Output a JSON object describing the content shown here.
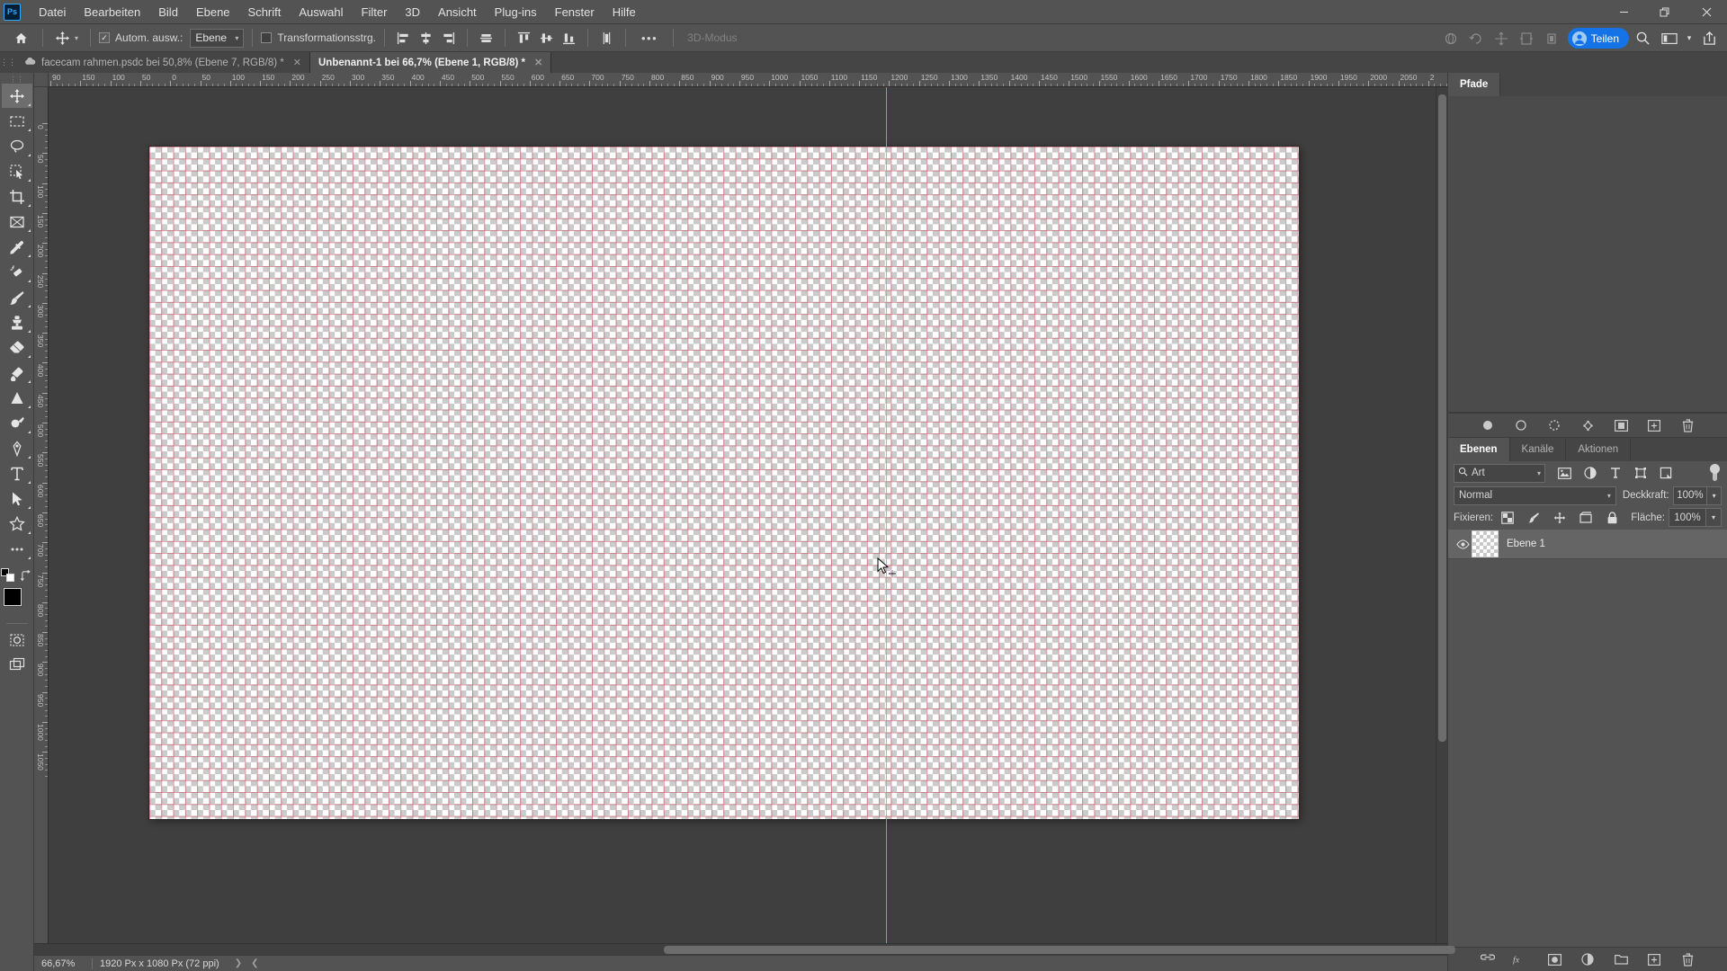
{
  "app": {
    "logo": "Ps"
  },
  "menubar": {
    "items": [
      {
        "label": "Datei"
      },
      {
        "label": "Bearbeiten"
      },
      {
        "label": "Bild"
      },
      {
        "label": "Ebene"
      },
      {
        "label": "Schrift"
      },
      {
        "label": "Auswahl"
      },
      {
        "label": "Filter"
      },
      {
        "label": "3D"
      },
      {
        "label": "Ansicht"
      },
      {
        "label": "Plug-ins"
      },
      {
        "label": "Fenster"
      },
      {
        "label": "Hilfe"
      }
    ],
    "window_controls": {
      "minimize": "─",
      "restore": "❐",
      "close": "✕"
    }
  },
  "options_bar": {
    "home_icon": "home-icon",
    "tool_icon": "move-tool-icon",
    "auto_select_label": "Autom. ausw.:",
    "auto_select_checked": true,
    "auto_select_value": "Ebene",
    "transform_controls_label": "Transformationsstrg.",
    "transform_controls_checked": false,
    "align_icons": [
      "align-left-edges-icon",
      "align-horizontal-centers-icon",
      "align-right-edges-icon",
      "align-vertical-centers-icon",
      "align-top-edges-icon",
      "align-vertical-middles-icon",
      "align-bottom-edges-icon",
      "distribute-icon"
    ],
    "more_label": "•••",
    "mode_3d_label": "3D-Modus",
    "mode_3d_icons": [
      "orbit-3d-icon",
      "roll-3d-icon",
      "pan-3d-icon",
      "slide-3d-icon",
      "scale-3d-icon"
    ],
    "share_label": "Teilen",
    "right_icons": [
      "search-icon",
      "workspace-icon",
      "chevron-down-icon",
      "share-export-icon"
    ]
  },
  "tabs": [
    {
      "label": "facecam rahmen.psdc bei 50,8% (Ebene 7, RGB/8) *",
      "active": false,
      "cloud": true,
      "close": "✕"
    },
    {
      "label": "Unbenannt-1 bei 66,7% (Ebene 1, RGB/8) *",
      "active": true,
      "cloud": false,
      "close": "✕"
    }
  ],
  "toolbar": {
    "tools": [
      {
        "name": "move-tool",
        "active": true
      },
      {
        "name": "rectangular-marquee-tool",
        "active": false
      },
      {
        "name": "lasso-tool",
        "active": false
      },
      {
        "name": "quick-selection-tool",
        "active": false
      },
      {
        "name": "crop-tool",
        "active": false
      },
      {
        "name": "frame-tool",
        "active": false
      },
      {
        "name": "eyedropper-tool",
        "active": false
      },
      {
        "name": "spot-healing-brush-tool",
        "active": false
      },
      {
        "name": "brush-tool",
        "active": false
      },
      {
        "name": "clone-stamp-tool",
        "active": false
      },
      {
        "name": "eraser-tool",
        "active": false
      },
      {
        "name": "gradient-tool",
        "active": false
      },
      {
        "name": "blur-tool",
        "active": false
      },
      {
        "name": "dodge-tool",
        "active": false
      },
      {
        "name": "pen-tool",
        "active": false
      },
      {
        "name": "type-tool",
        "active": false
      },
      {
        "name": "path-selection-tool",
        "active": false
      },
      {
        "name": "custom-shape-tool",
        "active": false
      },
      {
        "name": "edit-toolbar-tool",
        "active": false
      }
    ],
    "foreground_color": "#000000",
    "background_color": "#ffffff",
    "quick_mask_icon": "quick-mask-icon",
    "screen_mode_icon": "screen-mode-icon"
  },
  "rulers": {
    "unit": "px",
    "h_labels": [
      "90",
      "150",
      "100",
      "50",
      "0",
      "50",
      "100",
      "150",
      "200",
      "250",
      "300",
      "350",
      "400",
      "450",
      "500",
      "550",
      "600",
      "650",
      "700",
      "750",
      "800",
      "850",
      "900",
      "950",
      "1000",
      "1050",
      "1100",
      "1150",
      "1200",
      "1250",
      "1300",
      "1350",
      "1400",
      "1450",
      "1500",
      "1550",
      "1600",
      "1650",
      "1700",
      "1750",
      "1800",
      "1850",
      "1900",
      "1950",
      "2000",
      "2050",
      "2"
    ],
    "v_labels": [
      "0",
      "50",
      "100",
      "150",
      "200",
      "250",
      "300",
      "350",
      "400",
      "450",
      "500",
      "550",
      "600",
      "650",
      "700",
      "750",
      "800",
      "850",
      "900",
      "950",
      "1000",
      "1050"
    ]
  },
  "canvas": {
    "document_name": "Unbenannt-1",
    "zoom": "66,7%",
    "transparency_grid": true,
    "guide_color": "#5fc3d8",
    "grid_color": "#be465a",
    "cursor": "move-cursor"
  },
  "statusbar": {
    "zoom": "66,67%",
    "doc_info": "1920 Px x 1080 Px (72 ppi)",
    "next_arrow": "❯",
    "prev_arrow": "❮"
  },
  "panels": {
    "paths": {
      "tabs": [
        {
          "label": "Pfade",
          "active": true
        }
      ],
      "menu_icon": "panel-menu-icon",
      "footer_icons": [
        "fill-path-icon",
        "stroke-path-icon",
        "load-selection-icon",
        "make-work-path-icon",
        "add-mask-icon",
        "new-path-icon",
        "delete-path-icon"
      ]
    },
    "layers": {
      "tabs": [
        {
          "label": "Ebenen",
          "active": true
        },
        {
          "label": "Kanäle",
          "active": false
        },
        {
          "label": "Aktionen",
          "active": false
        }
      ],
      "menu_icon": "panel-menu-icon",
      "filter": {
        "search_icon": "search-icon",
        "kind_label": "Art",
        "chevron": "⌄",
        "type_icons": [
          "filter-pixel-icon",
          "filter-adjustment-icon",
          "filter-type-icon",
          "filter-shape-icon",
          "filter-smart-object-icon"
        ],
        "toggle_name": "filter-toggle"
      },
      "blend_mode": "Normal",
      "blend_chevron": "⌄",
      "opacity_label": "Deckkraft:",
      "opacity_value": "100%",
      "lock_label": "Fixieren:",
      "lock_icons": [
        "lock-transparent-pixels-icon",
        "lock-image-pixels-icon",
        "lock-position-icon",
        "lock-artboard-icon",
        "lock-all-icon"
      ],
      "fill_label": "Fläche:",
      "fill_value": "100%",
      "items": [
        {
          "name": "Ebene 1",
          "visible": true,
          "selected": true,
          "thumb": "transparent-thumb"
        }
      ],
      "footer_icons": [
        "link-layers-icon",
        "layer-style-icon",
        "add-mask-icon",
        "adjustment-layer-icon",
        "new-group-icon",
        "new-layer-icon",
        "delete-layer-icon"
      ]
    }
  }
}
